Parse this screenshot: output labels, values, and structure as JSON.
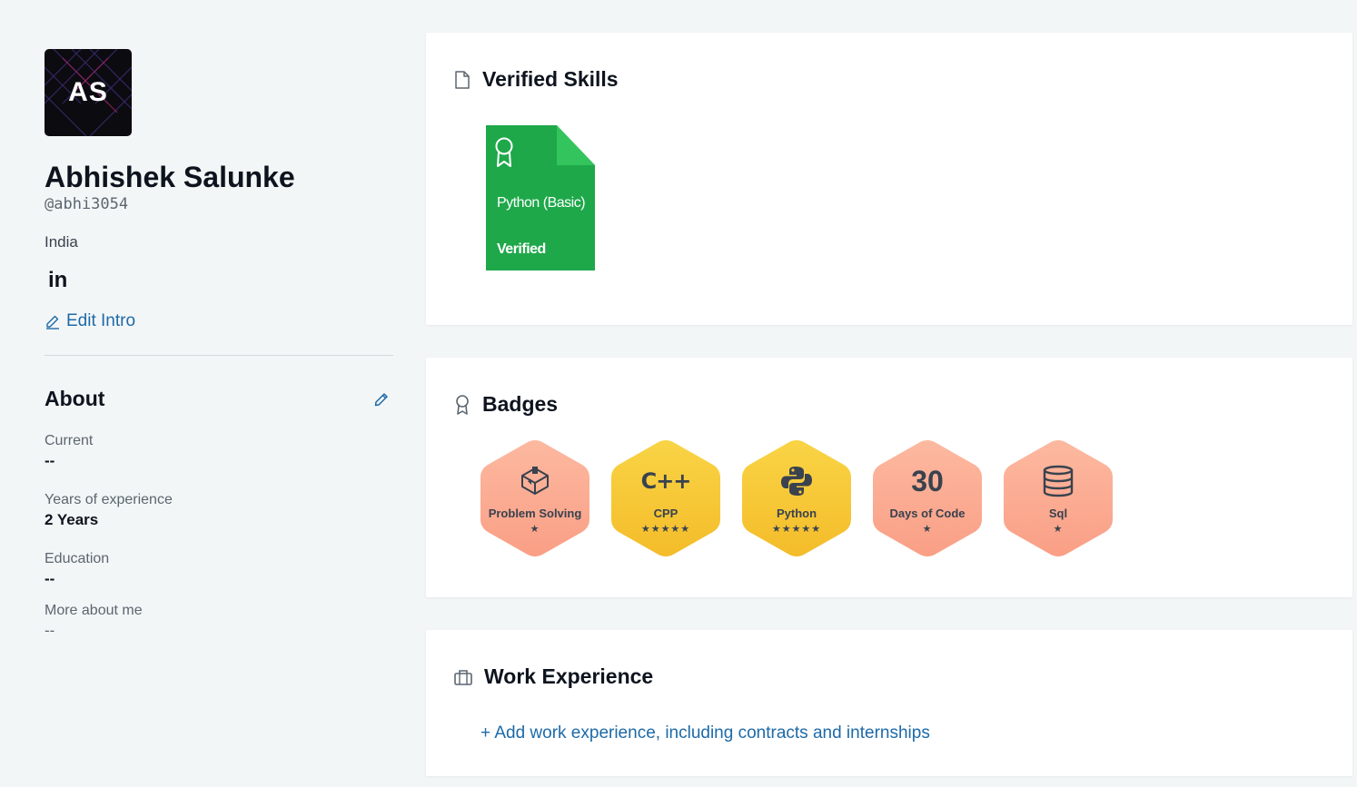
{
  "profile": {
    "initials": "AS",
    "name": "Abhishek Salunke",
    "handle": "@abhi3054",
    "country": "India",
    "linkedin_label": "in",
    "edit_intro_label": "Edit Intro"
  },
  "about": {
    "title": "About",
    "fields": [
      {
        "label": "Current",
        "value": "--"
      },
      {
        "label": "Years of experience",
        "value": "2 Years"
      },
      {
        "label": "Education",
        "value": "--"
      },
      {
        "label": "More about me",
        "value": "--"
      }
    ]
  },
  "verified_skills": {
    "title": "Verified Skills",
    "items": [
      {
        "name": "Python (Basic)",
        "status": "Verified",
        "color": "#1ea84a"
      }
    ]
  },
  "badges": {
    "title": "Badges",
    "items": [
      {
        "name": "Problem Solving",
        "stars": "★",
        "icon": "problem-solving-icon",
        "color": "#fba58a"
      },
      {
        "name": "CPP",
        "stars": "★★★★★",
        "icon": "cpp-icon",
        "icon_text": "C++",
        "color": "#f7c531"
      },
      {
        "name": "Python",
        "stars": "★★★★★",
        "icon": "python-icon",
        "color": "#f7c531"
      },
      {
        "name": "Days of Code",
        "stars": "★",
        "icon": "days-of-code-number",
        "icon_text": "30",
        "color": "#fba58a"
      },
      {
        "name": "Sql",
        "stars": "★",
        "icon": "database-icon",
        "color": "#fba58a"
      }
    ]
  },
  "work_experience": {
    "title": "Work Experience",
    "add_label": "+ Add work experience, including contracts and internships"
  }
}
